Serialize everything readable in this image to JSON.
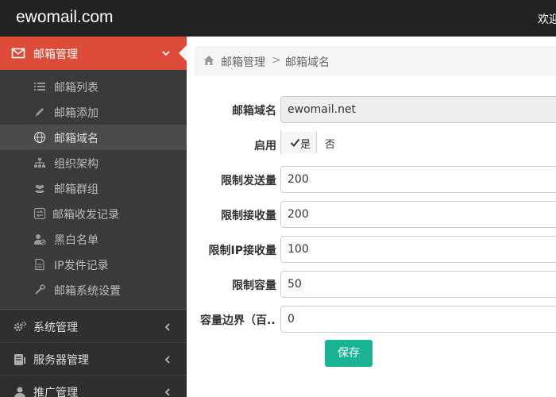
{
  "header": {
    "brand": "ewomail.com",
    "welcome": "欢迎"
  },
  "sidebar": {
    "active_menu": {
      "label": "邮箱管理",
      "icon": "envelope-icon"
    },
    "submenu": [
      {
        "label": "邮箱列表",
        "icon": "list-icon"
      },
      {
        "label": "邮箱添加",
        "icon": "pencil-icon"
      },
      {
        "label": "邮箱域名",
        "icon": "globe-icon",
        "active": true
      },
      {
        "label": "组织架构",
        "icon": "sitemap-icon"
      },
      {
        "label": "邮箱群组",
        "icon": "users-icon"
      },
      {
        "label": "邮箱收发记录",
        "icon": "exchange-icon"
      },
      {
        "label": "黑白名单",
        "icon": "user-block-icon"
      },
      {
        "label": "IP发件记录",
        "icon": "file-icon"
      },
      {
        "label": "邮箱系统设置",
        "icon": "wrench-icon"
      }
    ],
    "menus": [
      {
        "label": "系统管理",
        "icon": "cogs-icon"
      },
      {
        "label": "服务器管理",
        "icon": "server-icon"
      },
      {
        "label": "推广管理",
        "icon": "user-icon"
      }
    ]
  },
  "breadcrumb": {
    "parent": "邮箱管理",
    "separator": ">",
    "current": "邮箱域名"
  },
  "form": {
    "domain_label": "邮箱域名",
    "domain_value": "ewomail.net",
    "enable_label": "启用",
    "enable_yes": "是",
    "enable_no": "否",
    "send_limit_label": "限制发送量",
    "send_limit_value": "200",
    "recv_limit_label": "限制接收量",
    "recv_limit_value": "200",
    "ip_recv_limit_label": "限制IP接收量",
    "ip_recv_limit_value": "100",
    "capacity_label": "限制容量",
    "capacity_value": "50",
    "capacity_border_label": "容量边界（百...",
    "capacity_border_value": "0",
    "save_label": "保存"
  },
  "colors": {
    "active_menu": "#dd4b39",
    "save_button": "#1ab394"
  }
}
